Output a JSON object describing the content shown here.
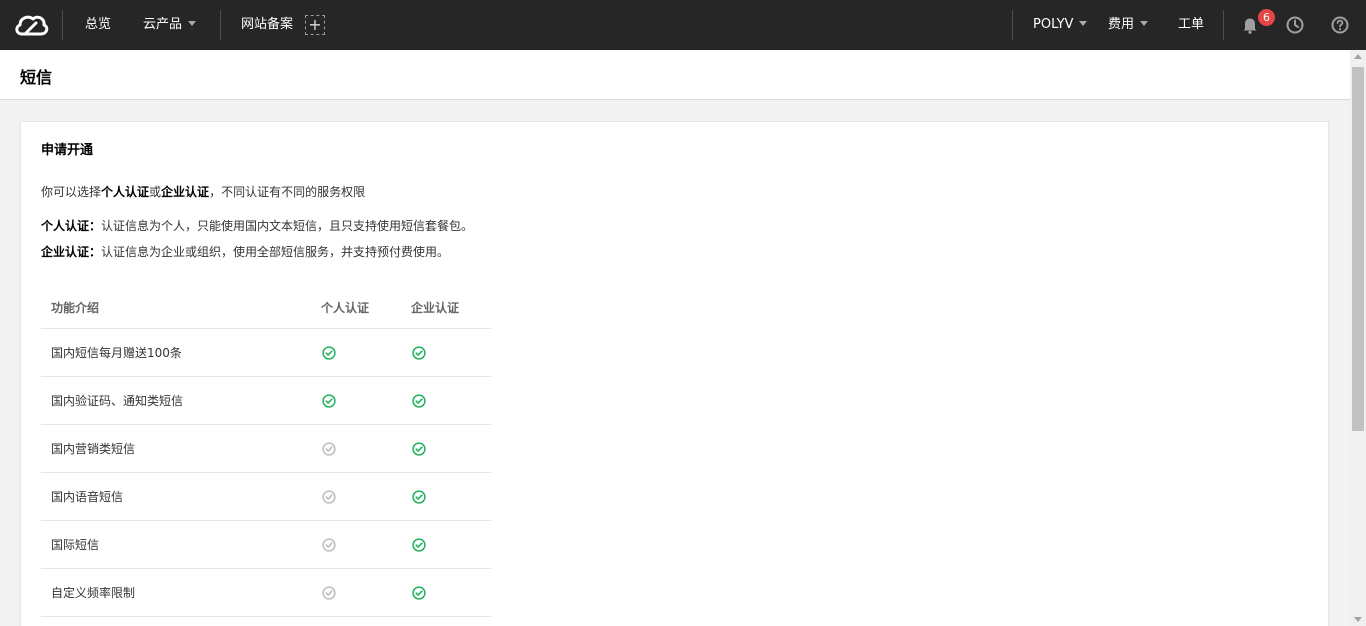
{
  "topnav": {
    "overview": "总览",
    "products": "云产品",
    "icp": "网站备案",
    "account": "POLYV",
    "billing": "费用",
    "tickets": "工单",
    "notification_count": "6"
  },
  "page": {
    "title": "短信"
  },
  "card": {
    "title": "申请开通",
    "intro": {
      "prefix": "你可以选择",
      "personal": "个人认证",
      "or": "或",
      "enterprise": "企业认证",
      "suffix": "，不同认证有不同的服务权限"
    },
    "personal_def": {
      "label": "个人认证：",
      "text": "认证信息为个人，只能使用国内文本短信，且只支持使用短信套餐包。"
    },
    "enterprise_def": {
      "label": "企业认证：",
      "text": "认证信息为企业或组织，使用全部短信服务，并支持预付费使用。"
    }
  },
  "table": {
    "headers": [
      "功能介绍",
      "个人认证",
      "企业认证"
    ],
    "rows": [
      {
        "feature": "国内短信每月赠送100条",
        "personal": true,
        "enterprise": true
      },
      {
        "feature": "国内验证码、通知类短信",
        "personal": true,
        "enterprise": true
      },
      {
        "feature": "国内营销类短信",
        "personal": false,
        "enterprise": true
      },
      {
        "feature": "国内语音短信",
        "personal": false,
        "enterprise": true
      },
      {
        "feature": "国际短信",
        "personal": false,
        "enterprise": true
      },
      {
        "feature": "自定义频率限制",
        "personal": false,
        "enterprise": true
      }
    ]
  },
  "colors": {
    "check_enabled": "#22b35e",
    "check_disabled": "#bdbdbd",
    "nav_bg": "#262626",
    "badge": "#e54545"
  },
  "icons": [
    "cloud-logo-icon",
    "add-icon",
    "bell-icon",
    "clock-icon",
    "help-icon",
    "check-circle-icon"
  ]
}
